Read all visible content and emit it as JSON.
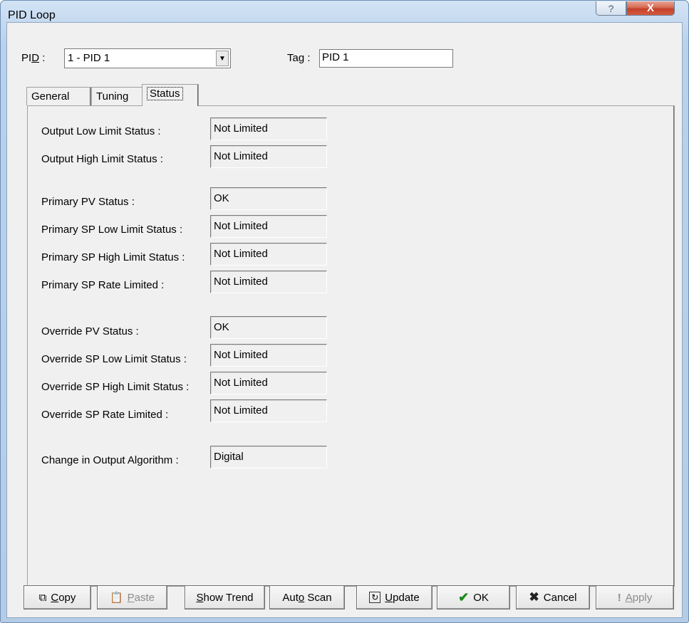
{
  "window": {
    "title": "PID Loop"
  },
  "titlebar": {
    "help_label": "?",
    "close_label": "X"
  },
  "header": {
    "pid_label_pre": "PI",
    "pid_label_ul": "D",
    "pid_label_post": " :",
    "pid_value": "1 - PID 1",
    "tag_label": "Tag :",
    "tag_value": "PID 1"
  },
  "tabs": [
    {
      "label": "General"
    },
    {
      "label": "Tuning"
    },
    {
      "label": "Status"
    }
  ],
  "status_fields": [
    {
      "label": "Output Low Limit Status :",
      "value": "Not Limited"
    },
    {
      "label": "Output High Limit Status :",
      "value": "Not Limited"
    },
    {
      "label": "Primary PV Status :",
      "value": "OK"
    },
    {
      "label": "Primary SP Low Limit Status :",
      "value": "Not Limited"
    },
    {
      "label": "Primary SP High Limit Status :",
      "value": "Not Limited"
    },
    {
      "label": "Primary SP Rate Limited :",
      "value": "Not Limited"
    },
    {
      "label": "Override PV Status :",
      "value": "OK"
    },
    {
      "label": "Override SP Low Limit Status :",
      "value": "Not Limited"
    },
    {
      "label": "Override SP High Limit Status :",
      "value": "Not Limited"
    },
    {
      "label": "Override SP Rate Limited :",
      "value": "Not Limited"
    },
    {
      "label": "Change in Output Algorithm :",
      "value": "Digital"
    }
  ],
  "buttons": {
    "copy": {
      "ul": "C",
      "rest": "opy",
      "icon": "copy-icon"
    },
    "paste": {
      "ul": "P",
      "rest": "aste",
      "icon": "paste-icon"
    },
    "show_trend": {
      "ul": "S",
      "rest": "how Trend"
    },
    "auto_scan": {
      "pre": "Aut",
      "ul": "o",
      "rest": " Scan"
    },
    "update": {
      "ul": "U",
      "rest": "pdate",
      "icon": "refresh-icon"
    },
    "ok": {
      "label": "OK",
      "icon": "checkmark-icon"
    },
    "cancel": {
      "label": "Cancel",
      "icon": "x-icon"
    },
    "apply": {
      "ul": "A",
      "rest": "pply",
      "icon": "exclamation-icon"
    }
  }
}
